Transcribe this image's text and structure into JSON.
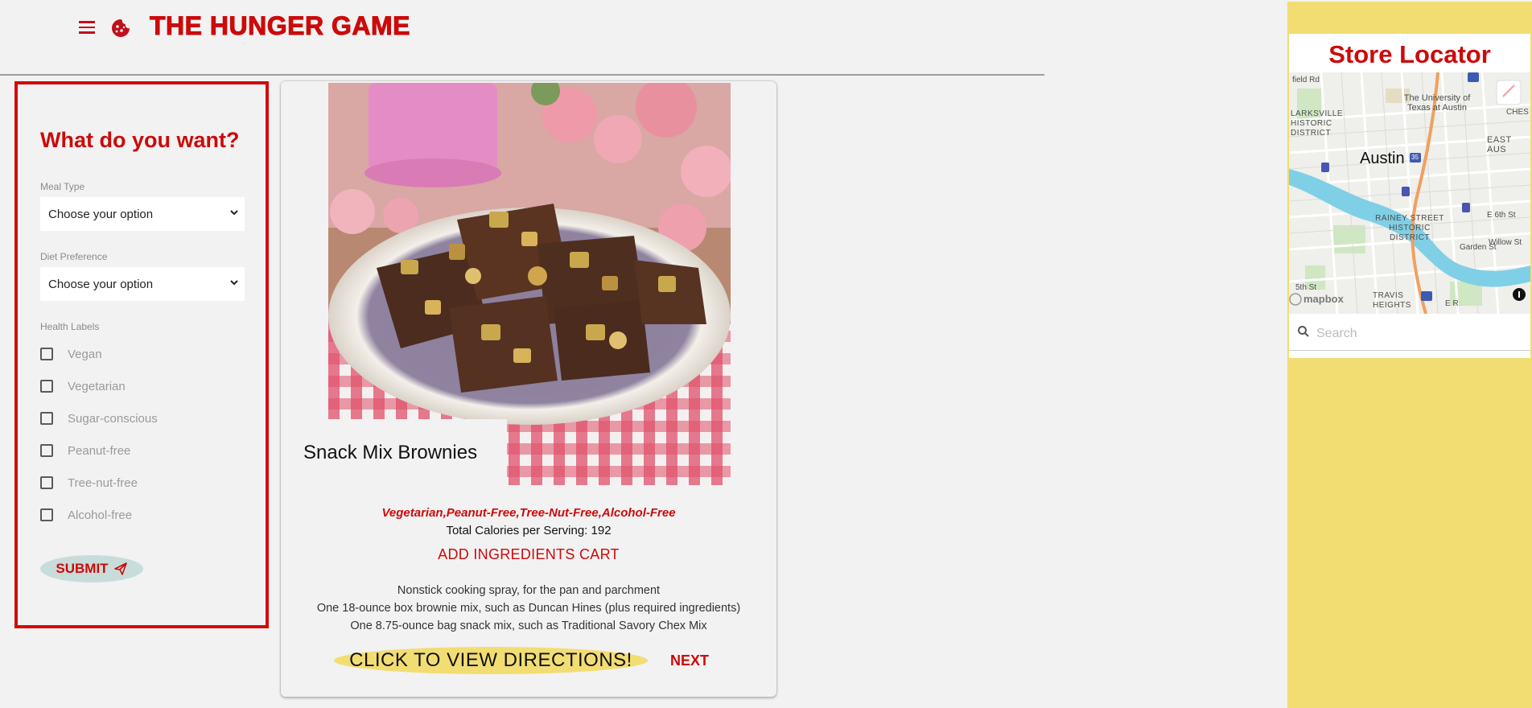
{
  "header": {
    "app_title": "THE HUNGER GAME",
    "icons": [
      "menu-icon",
      "cookie-icon"
    ],
    "brand_color": "#cc0a0a"
  },
  "form": {
    "title": "What do you want?",
    "meal_type": {
      "label": "Meal Type",
      "value": "Choose your option"
    },
    "diet_preference": {
      "label": "Diet Preference",
      "value": "Choose your option"
    },
    "health_labels": {
      "label": "Health Labels",
      "options": [
        "Vegan",
        "Vegetarian",
        "Sugar-conscious",
        "Peanut-free",
        "Tree-nut-free",
        "Alcohol-free"
      ]
    },
    "submit_label": "SUBMIT"
  },
  "recipe": {
    "title": "Snack Mix Brownies",
    "health_tags": "Vegetarian,Peanut-Free,Tree-Nut-Free,Alcohol-Free",
    "calories": "Total Calories per Serving: 192",
    "add_cart_label": "ADD INGREDIENTS CART",
    "ingredients": [
      "Nonstick cooking spray, for the pan and parchment",
      "One 18-ounce box brownie mix, such as Duncan Hines (plus required ingredients)",
      "One 8.75-ounce bag snack mix, such as Traditional Savory Chex Mix"
    ],
    "directions_label": "CLICK TO VIEW DIRECTIONS!",
    "next_label": "NEXT"
  },
  "sidebar": {
    "title": "Store Locator",
    "map": {
      "labels": {
        "university": "The University of Texas at Austin",
        "clarksville": "LARKSVILLE HISTORIC DISTRICT",
        "city": "Austin",
        "east_austin": "EAST AUS",
        "rainey": "RAINEY STREET HISTORIC DISTRICT",
        "travis": "TRAVIS HEIGHTS",
        "field_rd": "field Rd",
        "e6th": "E 6th St",
        "willow": "Willow St",
        "garden": "Garden St",
        "ches": "CHES",
        "fifth": "5th St",
        "hwy": "35",
        "mapbox": "mapbox",
        "er": "E R"
      }
    },
    "search_placeholder": "Search",
    "accent_color": "#f2dd72"
  }
}
